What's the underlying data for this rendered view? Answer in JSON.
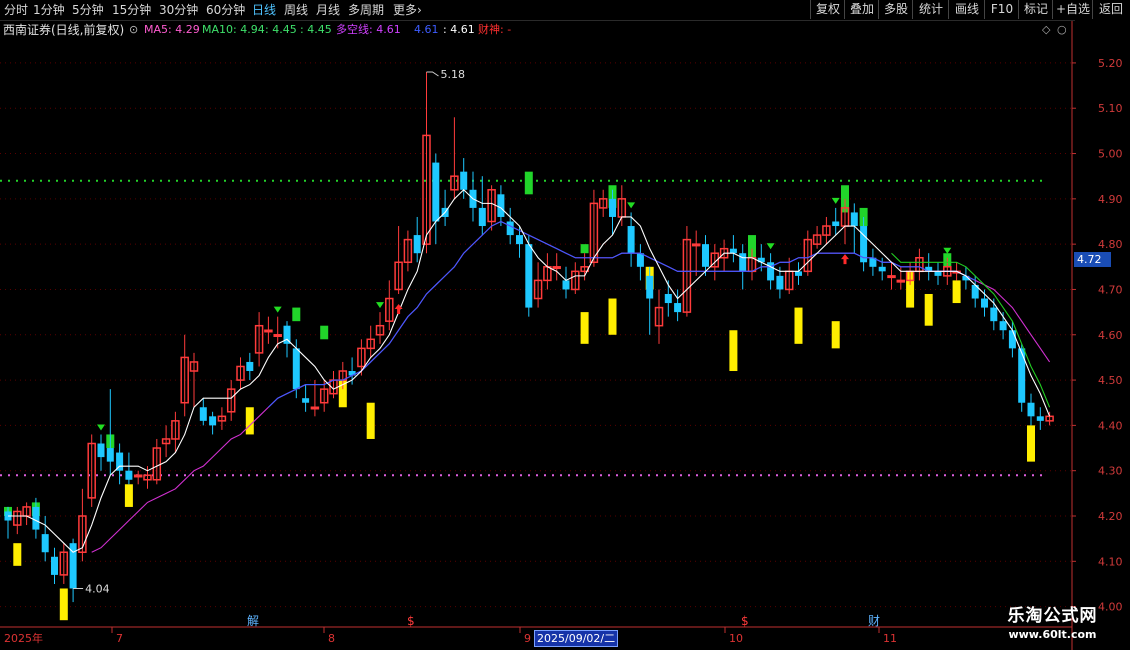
{
  "toolbar": {
    "timeframes": [
      "分时",
      "1分钟",
      "5分钟",
      "15分钟",
      "30分钟",
      "60分钟",
      "日线",
      "周线",
      "月线",
      "多周期",
      "更多"
    ],
    "active_timeframe": "日线",
    "more_arrow": "›",
    "right_buttons": [
      "复权",
      "叠加",
      "多股",
      "统计",
      "画线",
      "F10",
      "标记",
      "+自选",
      "返回"
    ]
  },
  "info": {
    "title": "西南证券(日线,前复权)",
    "ma5": "MA5: 4.29",
    "ma10": "MA10: 4.94",
    "v1": ": 4.45",
    "v2": ": 4.45",
    "duokong": "多空线: 4.61",
    "v3": "4.61",
    "v4": ": 4.61",
    "caishen": "财神: -"
  },
  "colors": {
    "up": "#ff3b3b",
    "down": "#1ec8ff",
    "green_bar": "#21d52a",
    "yellow_bar": "#ffee00",
    "ma_white": "#ffffff",
    "ma_blue": "#3d5cff",
    "ma_magenta": "#d030d0",
    "ma_green": "#22cc22",
    "grid": "#5a0000",
    "axis": "#c03030"
  },
  "price_axis": {
    "labels": [
      "5.20",
      "5.10",
      "5.00",
      "4.90",
      "4.80",
      "4.70",
      "4.60",
      "4.50",
      "4.40",
      "4.30",
      "4.20",
      "4.10",
      "4.00"
    ],
    "current_tag": "4.72",
    "range": [
      3.955,
      5.255
    ]
  },
  "annotations": {
    "high": "5.18",
    "low": "4.04"
  },
  "events": {
    "jie": "解",
    "money1": "$",
    "money2": "$",
    "cai": "财"
  },
  "date_axis": {
    "segments": [
      "2025年",
      "7",
      "8",
      "9",
      "10",
      "11"
    ],
    "selected": "2025/09/02/二"
  },
  "watermark": {
    "line1": "乐淘公式网",
    "line2": "www.60lt.com"
  },
  "chart_data": {
    "type": "candlestick",
    "candles": [
      [
        4.21,
        4.19,
        4.22,
        4.15
      ],
      [
        4.18,
        4.21,
        4.22,
        4.16
      ],
      [
        4.2,
        4.22,
        4.23,
        4.18
      ],
      [
        4.22,
        4.17,
        4.24,
        4.15
      ],
      [
        4.16,
        4.12,
        4.2,
        4.1
      ],
      [
        4.11,
        4.07,
        4.13,
        4.05
      ],
      [
        4.07,
        4.12,
        4.14,
        4.05
      ],
      [
        4.14,
        4.04,
        4.15,
        4.01
      ],
      [
        4.12,
        4.2,
        4.26,
        4.1
      ],
      [
        4.24,
        4.36,
        4.38,
        4.22
      ],
      [
        4.36,
        4.33,
        4.38,
        4.3
      ],
      [
        4.35,
        4.32,
        4.48,
        4.29
      ],
      [
        4.34,
        4.3,
        4.36,
        4.27
      ],
      [
        4.3,
        4.28,
        4.34,
        4.27
      ],
      [
        4.29,
        4.29,
        4.3,
        4.27
      ],
      [
        4.28,
        4.29,
        4.31,
        4.26
      ],
      [
        4.28,
        4.35,
        4.37,
        4.27
      ],
      [
        4.36,
        4.37,
        4.4,
        4.33
      ],
      [
        4.37,
        4.41,
        4.43,
        4.34
      ],
      [
        4.45,
        4.55,
        4.6,
        4.42
      ],
      [
        4.52,
        4.54,
        4.56,
        4.44
      ],
      [
        4.44,
        4.41,
        4.46,
        4.4
      ],
      [
        4.42,
        4.4,
        4.43,
        4.38
      ],
      [
        4.41,
        4.42,
        4.44,
        4.39
      ],
      [
        4.43,
        4.48,
        4.5,
        4.41
      ],
      [
        4.5,
        4.53,
        4.55,
        4.48
      ],
      [
        4.54,
        4.52,
        4.56,
        4.5
      ],
      [
        4.56,
        4.62,
        4.65,
        4.53
      ],
      [
        4.61,
        4.61,
        4.64,
        4.58
      ],
      [
        4.6,
        4.6,
        4.64,
        4.57
      ],
      [
        4.62,
        4.58,
        4.63,
        4.55
      ],
      [
        4.57,
        4.48,
        4.59,
        4.46
      ],
      [
        4.46,
        4.45,
        4.49,
        4.43
      ],
      [
        4.44,
        4.44,
        4.5,
        4.42
      ],
      [
        4.45,
        4.48,
        4.5,
        4.43
      ],
      [
        4.47,
        4.5,
        4.52,
        4.46
      ],
      [
        4.5,
        4.52,
        4.54,
        4.48
      ],
      [
        4.52,
        4.51,
        4.55,
        4.49
      ],
      [
        4.53,
        4.57,
        4.59,
        4.51
      ],
      [
        4.57,
        4.59,
        4.62,
        4.55
      ],
      [
        4.6,
        4.62,
        4.65,
        4.58
      ],
      [
        4.63,
        4.68,
        4.72,
        4.61
      ],
      [
        4.7,
        4.76,
        4.84,
        4.69
      ],
      [
        4.76,
        4.81,
        4.83,
        4.74
      ],
      [
        4.82,
        4.78,
        4.86,
        4.76
      ],
      [
        4.8,
        5.04,
        5.18,
        4.78
      ],
      [
        4.98,
        4.85,
        5.0,
        4.8
      ],
      [
        4.88,
        4.86,
        4.92,
        4.84
      ],
      [
        4.92,
        4.95,
        5.08,
        4.9
      ],
      [
        4.96,
        4.92,
        4.99,
        4.9
      ],
      [
        4.92,
        4.88,
        4.96,
        4.85
      ],
      [
        4.88,
        4.84,
        4.95,
        4.82
      ],
      [
        4.85,
        4.92,
        4.93,
        4.83
      ],
      [
        4.91,
        4.86,
        4.93,
        4.84
      ],
      [
        4.85,
        4.82,
        4.88,
        4.8
      ],
      [
        4.82,
        4.8,
        4.84,
        4.77
      ],
      [
        4.8,
        4.66,
        4.82,
        4.64
      ],
      [
        4.68,
        4.72,
        4.76,
        4.66
      ],
      [
        4.72,
        4.75,
        4.78,
        4.7
      ],
      [
        4.75,
        4.75,
        4.78,
        4.72
      ],
      [
        4.72,
        4.7,
        4.75,
        4.68
      ],
      [
        4.7,
        4.74,
        4.76,
        4.69
      ],
      [
        4.74,
        4.75,
        4.78,
        4.72
      ],
      [
        4.76,
        4.89,
        4.92,
        4.75
      ],
      [
        4.88,
        4.9,
        4.92,
        4.86
      ],
      [
        4.9,
        4.86,
        4.92,
        4.82
      ],
      [
        4.86,
        4.9,
        4.93,
        4.84
      ],
      [
        4.84,
        4.78,
        4.87,
        4.75
      ],
      [
        4.78,
        4.75,
        4.8,
        4.72
      ],
      [
        4.73,
        4.68,
        4.75,
        4.6
      ],
      [
        4.62,
        4.66,
        4.7,
        4.58
      ],
      [
        4.69,
        4.67,
        4.72,
        4.64
      ],
      [
        4.67,
        4.65,
        4.7,
        4.63
      ],
      [
        4.65,
        4.81,
        4.84,
        4.64
      ],
      [
        4.8,
        4.8,
        4.83,
        4.73
      ],
      [
        4.8,
        4.75,
        4.82,
        4.73
      ],
      [
        4.75,
        4.78,
        4.8,
        4.72
      ],
      [
        4.77,
        4.79,
        4.81,
        4.74
      ],
      [
        4.79,
        4.78,
        4.82,
        4.76
      ],
      [
        4.78,
        4.74,
        4.8,
        4.7
      ],
      [
        4.74,
        4.77,
        4.79,
        4.72
      ],
      [
        4.77,
        4.76,
        4.8,
        4.74
      ],
      [
        4.76,
        4.72,
        4.78,
        4.7
      ],
      [
        4.73,
        4.7,
        4.75,
        4.68
      ],
      [
        4.7,
        4.74,
        4.77,
        4.69
      ],
      [
        4.74,
        4.73,
        4.76,
        4.71
      ],
      [
        4.74,
        4.81,
        4.83,
        4.73
      ],
      [
        4.8,
        4.82,
        4.84,
        4.79
      ],
      [
        4.82,
        4.84,
        4.86,
        4.8
      ],
      [
        4.85,
        4.84,
        4.88,
        4.82
      ],
      [
        4.84,
        4.88,
        4.9,
        4.8
      ],
      [
        4.87,
        4.84,
        4.89,
        4.78
      ],
      [
        4.84,
        4.76,
        4.86,
        4.74
      ],
      [
        4.77,
        4.75,
        4.79,
        4.73
      ],
      [
        4.75,
        4.74,
        4.77,
        4.72
      ],
      [
        4.73,
        4.73,
        4.76,
        4.7
      ],
      [
        4.72,
        4.72,
        4.75,
        4.7
      ],
      [
        4.72,
        4.74,
        4.76,
        4.71
      ],
      [
        4.74,
        4.77,
        4.79,
        4.72
      ],
      [
        4.75,
        4.74,
        4.78,
        4.72
      ],
      [
        4.74,
        4.73,
        4.76,
        4.71
      ],
      [
        4.73,
        4.75,
        4.77,
        4.71
      ],
      [
        4.74,
        4.74,
        4.76,
        4.72
      ],
      [
        4.73,
        4.72,
        4.75,
        4.7
      ],
      [
        4.71,
        4.68,
        4.73,
        4.66
      ],
      [
        4.68,
        4.66,
        4.7,
        4.64
      ],
      [
        4.66,
        4.63,
        4.68,
        4.61
      ],
      [
        4.63,
        4.61,
        4.65,
        4.59
      ],
      [
        4.61,
        4.57,
        4.63,
        4.55
      ],
      [
        4.57,
        4.45,
        4.58,
        4.43
      ],
      [
        4.45,
        4.42,
        4.47,
        4.4
      ],
      [
        4.42,
        4.41,
        4.44,
        4.39
      ],
      [
        4.41,
        4.42,
        4.43,
        4.4
      ]
    ],
    "ma_white": [
      4.2,
      4.2,
      4.2,
      4.19,
      4.18,
      4.16,
      4.14,
      4.12,
      4.13,
      4.18,
      4.24,
      4.29,
      4.31,
      4.31,
      4.31,
      4.3,
      4.31,
      4.32,
      4.34,
      4.38,
      4.44,
      4.46,
      4.46,
      4.46,
      4.46,
      4.48,
      4.49,
      4.51,
      4.55,
      4.58,
      4.59,
      4.57,
      4.55,
      4.53,
      4.5,
      4.48,
      4.49,
      4.5,
      4.52,
      4.55,
      4.57,
      4.6,
      4.65,
      4.7,
      4.74,
      4.82,
      4.85,
      4.87,
      4.9,
      4.92,
      4.9,
      4.89,
      4.89,
      4.88,
      4.86,
      4.84,
      4.8,
      4.77,
      4.75,
      4.74,
      4.72,
      4.73,
      4.73,
      4.77,
      4.8,
      4.82,
      4.86,
      4.86,
      4.84,
      4.79,
      4.75,
      4.71,
      4.68,
      4.7,
      4.72,
      4.74,
      4.76,
      4.78,
      4.78,
      4.77,
      4.77,
      4.76,
      4.75,
      4.74,
      4.74,
      4.74,
      4.76,
      4.78,
      4.8,
      4.82,
      4.84,
      4.84,
      4.82,
      4.8,
      4.78,
      4.76,
      4.74,
      4.74,
      4.74,
      4.74,
      4.74,
      4.74,
      4.74,
      4.73,
      4.71,
      4.69,
      4.67,
      4.64,
      4.61,
      4.56,
      4.51,
      4.47,
      4.42
    ],
    "ma_magenta": [
      null,
      null,
      null,
      null,
      null,
      null,
      null,
      null,
      null,
      4.12,
      4.13,
      4.15,
      4.17,
      4.19,
      4.21,
      4.23,
      4.24,
      4.25,
      4.26,
      4.28,
      4.3,
      4.31,
      4.33,
      4.35,
      4.37,
      4.38,
      4.4,
      4.42,
      4.44,
      4.46,
      4.47,
      4.48,
      4.49,
      4.49,
      4.49,
      4.5,
      4.5,
      4.51,
      4.52,
      4.54,
      4.56,
      4.58,
      4.61,
      4.64,
      4.66,
      4.69,
      4.71,
      4.73,
      4.75,
      4.78,
      4.8,
      4.82,
      4.84,
      4.85,
      4.84,
      4.83,
      4.82,
      4.81,
      4.8,
      4.79,
      4.78,
      4.77,
      4.77,
      4.77,
      4.77,
      4.77,
      4.78,
      4.78,
      4.78,
      4.77,
      4.76,
      4.75,
      4.74,
      4.74,
      4.74,
      4.74,
      4.74,
      4.74,
      4.74,
      4.74,
      4.74,
      4.75,
      4.75,
      4.76,
      4.76,
      4.77,
      4.77,
      4.78,
      4.78,
      4.78,
      4.78,
      4.78,
      4.77,
      4.77,
      4.76,
      4.76,
      4.75,
      4.75,
      4.75,
      4.74,
      4.74,
      4.74,
      4.74,
      4.73,
      4.72,
      4.71,
      4.7,
      4.68,
      4.66,
      4.63,
      4.6,
      4.57,
      4.54
    ],
    "ma_blue_start": 28,
    "ma_blue_end": 104,
    "green_bars": [
      [
        0,
        4.22,
        4.2
      ],
      [
        3,
        4.23,
        4.2
      ],
      [
        11,
        4.38,
        4.35
      ],
      [
        31,
        4.66,
        4.63
      ],
      [
        34,
        4.62,
        4.59
      ],
      [
        56,
        4.96,
        4.91
      ],
      [
        62,
        4.8,
        4.78
      ],
      [
        65,
        4.93,
        4.88
      ],
      [
        80,
        4.82,
        4.77
      ],
      [
        90,
        4.93,
        4.87
      ],
      [
        92,
        4.88,
        4.84
      ],
      [
        101,
        4.78,
        4.75
      ]
    ],
    "yellow_bars": [
      [
        1,
        4.14,
        4.09
      ],
      [
        6,
        4.04,
        3.97
      ],
      [
        13,
        4.27,
        4.22
      ],
      [
        26,
        4.44,
        4.38
      ],
      [
        36,
        4.5,
        4.44
      ],
      [
        39,
        4.45,
        4.37
      ],
      [
        62,
        4.65,
        4.58
      ],
      [
        65,
        4.68,
        4.6
      ],
      [
        69,
        4.75,
        4.7
      ],
      [
        78,
        4.61,
        4.52
      ],
      [
        85,
        4.66,
        4.58
      ],
      [
        89,
        4.63,
        4.57
      ],
      [
        97,
        4.74,
        4.66
      ],
      [
        99,
        4.69,
        4.62
      ],
      [
        102,
        4.72,
        4.67
      ],
      [
        110,
        4.4,
        4.32
      ]
    ],
    "down_arrows": [
      10,
      29,
      40,
      67,
      82,
      89,
      101
    ],
    "up_arrows": [
      42,
      90
    ]
  }
}
